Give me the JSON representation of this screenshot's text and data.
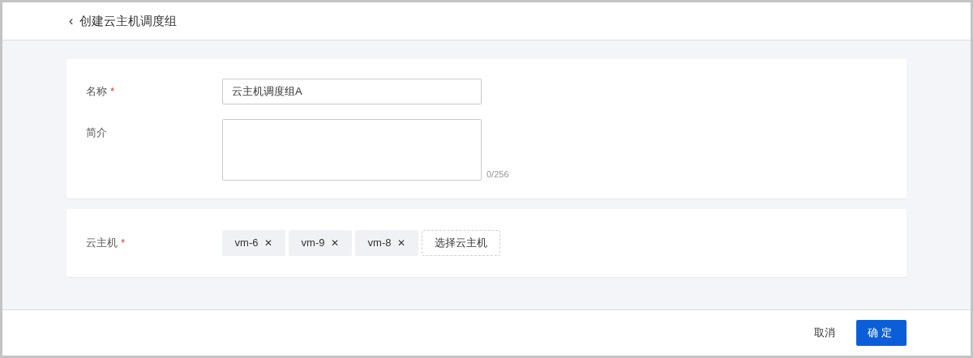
{
  "header": {
    "back_icon": "‹",
    "title": "创建云主机调度组"
  },
  "required_mark": "*",
  "basic_form": {
    "fields": [
      {
        "kind": "input",
        "label": "名称",
        "required": true,
        "value": "云主机调度组A"
      },
      {
        "kind": "textarea",
        "label": "简介",
        "required": false,
        "counter": "0/256"
      }
    ]
  },
  "host_form": {
    "label": "云主机",
    "required": true,
    "tags": [
      {
        "text": "vm-6",
        "remove": "✕"
      },
      {
        "text": "vm-9",
        "remove": "✕"
      },
      {
        "text": "vm-8",
        "remove": "✕"
      }
    ],
    "select_button": "选择云主机"
  },
  "footer": {
    "cancel": "取消",
    "confirm": "确定"
  }
}
